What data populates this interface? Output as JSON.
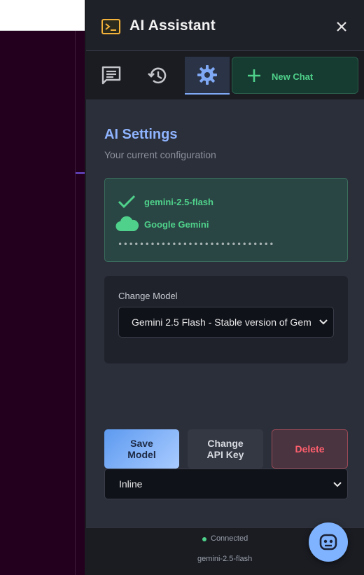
{
  "panel": {
    "title": "AI Assistant",
    "icons": {
      "app": "terminal-icon",
      "close": "close-icon"
    }
  },
  "tabs": [
    {
      "name": "chat",
      "icon": "chat-icon",
      "active": false
    },
    {
      "name": "history",
      "icon": "history-icon",
      "active": false
    },
    {
      "name": "settings",
      "icon": "gear-icon",
      "active": true
    }
  ],
  "new_chat": {
    "label": "New Chat",
    "icon": "plus-icon"
  },
  "settings": {
    "title": "AI Settings",
    "subtitle": "Your current configuration",
    "current": {
      "model": "gemini-2.5-flash",
      "provider": "Google Gemini",
      "api_key_masked": "•••••••••••••••••••••••••••••"
    },
    "change_model": {
      "label": "Change Model",
      "selected": "Gemini 2.5 Flash - Stable version of Gem"
    },
    "buttons": {
      "save": "Save Model",
      "change_api_key": "Change API Key",
      "delete": "Delete"
    },
    "mode": {
      "selected": "Inline"
    }
  },
  "status": {
    "connection": "Connected",
    "model": "gemini-2.5-flash"
  },
  "colors": {
    "accent_blue": "#8fb4ff",
    "success_green": "#4fd18b",
    "danger_red": "#ff5f6d",
    "terminal_orange": "#f3b23a"
  }
}
